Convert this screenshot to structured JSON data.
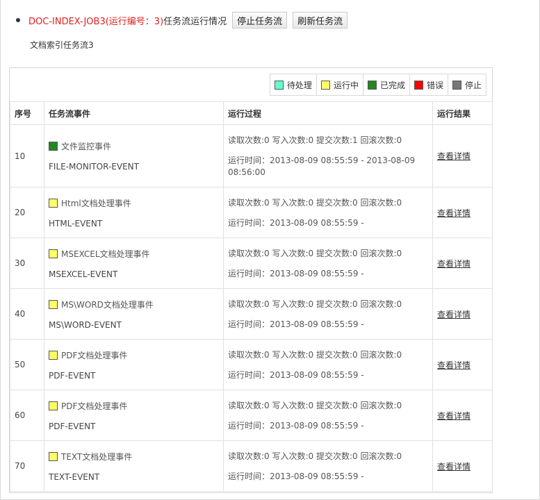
{
  "header": {
    "job_red": "DOC-INDEX-JOB3(运行编号：3)",
    "job_rest": "任务流运行情况",
    "stop_btn": "停止任务流",
    "refresh_btn": "刷新任务流"
  },
  "subtitle": "文档索引任务流3",
  "legend": [
    {
      "label": "待处理",
      "color": "#66ffcc"
    },
    {
      "label": "运行中",
      "color": "#ffff66"
    },
    {
      "label": "已完成",
      "color": "#228822"
    },
    {
      "label": "错误",
      "color": "#ff0000"
    },
    {
      "label": "停止",
      "color": "#777777"
    }
  ],
  "columns": [
    "序号",
    "任务流事件",
    "运行过程",
    "运行结果"
  ],
  "rows": [
    {
      "seq": "10",
      "name": "文件监控事件",
      "code": "FILE-MONITOR-EVENT",
      "status_color": "#228822",
      "counts": "读取次数:0 写入次数:0 提交次数:1 回滚次数:0",
      "time": "运行时间：2013-08-09 08:55:59 - 2013-08-09 08:56:00",
      "link": "查看详情"
    },
    {
      "seq": "20",
      "name": "Html文档处理事件",
      "code": "HTML-EVENT",
      "status_color": "#ffff66",
      "counts": "读取次数:0 写入次数:0 提交次数:0 回滚次数:0",
      "time": "运行时间：2013-08-09 08:55:59 -",
      "link": "查看详情"
    },
    {
      "seq": "30",
      "name": "MSEXCEL文档处理事件",
      "code": "MSEXCEL-EVENT",
      "status_color": "#ffff66",
      "counts": "读取次数:0 写入次数:0 提交次数:0 回滚次数:0",
      "time": "运行时间：2013-08-09 08:55:59 -",
      "link": "查看详情"
    },
    {
      "seq": "40",
      "name": "MS\\WORD文档处理事件",
      "code": "MS\\WORD-EVENT",
      "status_color": "#ffff66",
      "counts": "读取次数:0 写入次数:0 提交次数:0 回滚次数:0",
      "time": "运行时间：2013-08-09 08:55:59 -",
      "link": "查看详情"
    },
    {
      "seq": "50",
      "name": "PDF文档处理事件",
      "code": "PDF-EVENT",
      "status_color": "#ffff66",
      "counts": "读取次数:0 写入次数:0 提交次数:0 回滚次数:0",
      "time": "运行时间：2013-08-09 08:55:59 -",
      "link": "查看详情"
    },
    {
      "seq": "60",
      "name": "PDF文档处理事件",
      "code": "PDF-EVENT",
      "status_color": "#ffff66",
      "counts": "读取次数:0 写入次数:0 提交次数:0 回滚次数:0",
      "time": "运行时间：2013-08-09 08:55:59 -",
      "link": "查看详情"
    },
    {
      "seq": "70",
      "name": "TEXT文档处理事件",
      "code": "TEXT-EVENT",
      "status_color": "#ffff66",
      "counts": "读取次数:0 写入次数:0 提交次数:0 回滚次数:0",
      "time": "运行时间：2013-08-09 08:55:59 -",
      "link": "查看详情"
    }
  ]
}
